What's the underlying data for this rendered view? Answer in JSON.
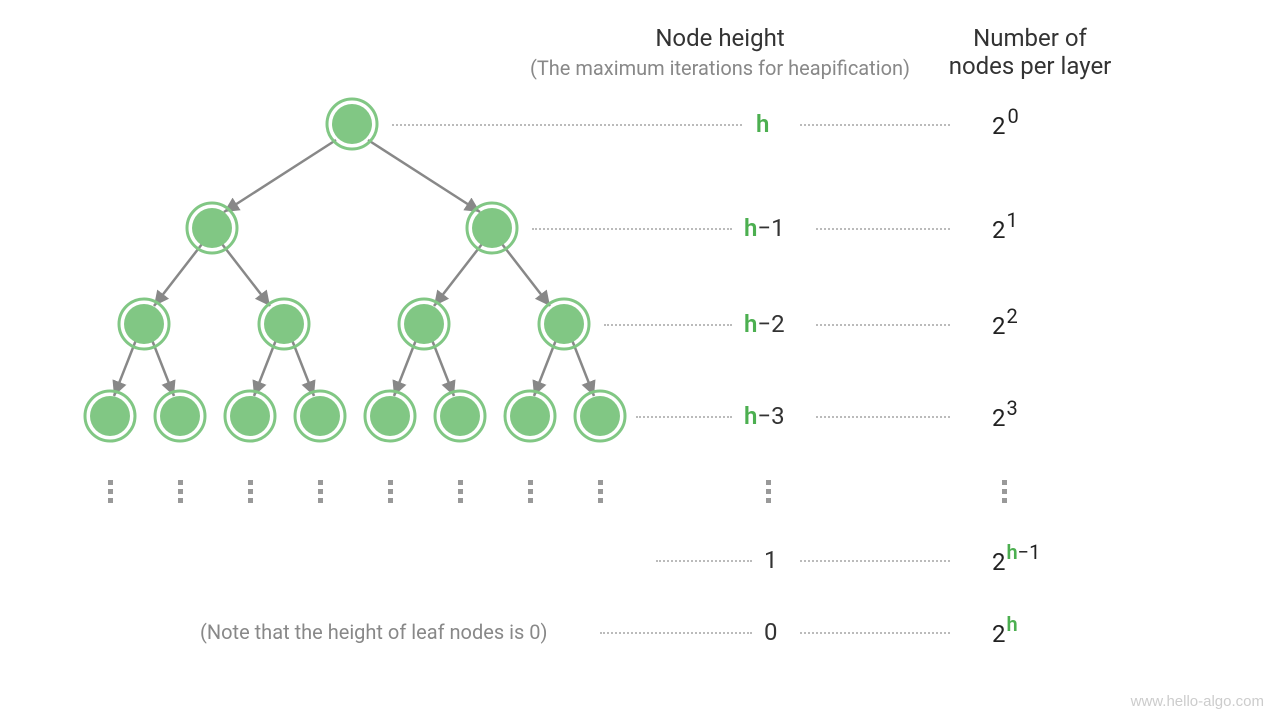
{
  "headers": {
    "height_title": "Node height",
    "height_sub": "(The maximum iterations for heapification)",
    "count_title_l1": "Number of",
    "count_title_l2": "nodes per layer"
  },
  "rows": [
    {
      "height_h": "h",
      "height_suffix": "",
      "count_base": "2",
      "count_exp": "0"
    },
    {
      "height_h": "h",
      "height_suffix": "−1",
      "count_base": "2",
      "count_exp": "1"
    },
    {
      "height_h": "h",
      "height_suffix": "−2",
      "count_base": "2",
      "count_exp": "2"
    },
    {
      "height_h": "h",
      "height_suffix": "−3",
      "count_base": "2",
      "count_exp": "3"
    }
  ],
  "lower": {
    "row_one": {
      "height": "1",
      "count_base": "2",
      "count_exp_h": "h",
      "count_exp_suffix": "−1"
    },
    "row_zero": {
      "height": "0",
      "count_base": "2",
      "count_exp_h": "h",
      "count_exp_suffix": ""
    }
  },
  "note": "(Note that the height of leaf nodes is 0)",
  "watermark": "www.hello-algo.com"
}
